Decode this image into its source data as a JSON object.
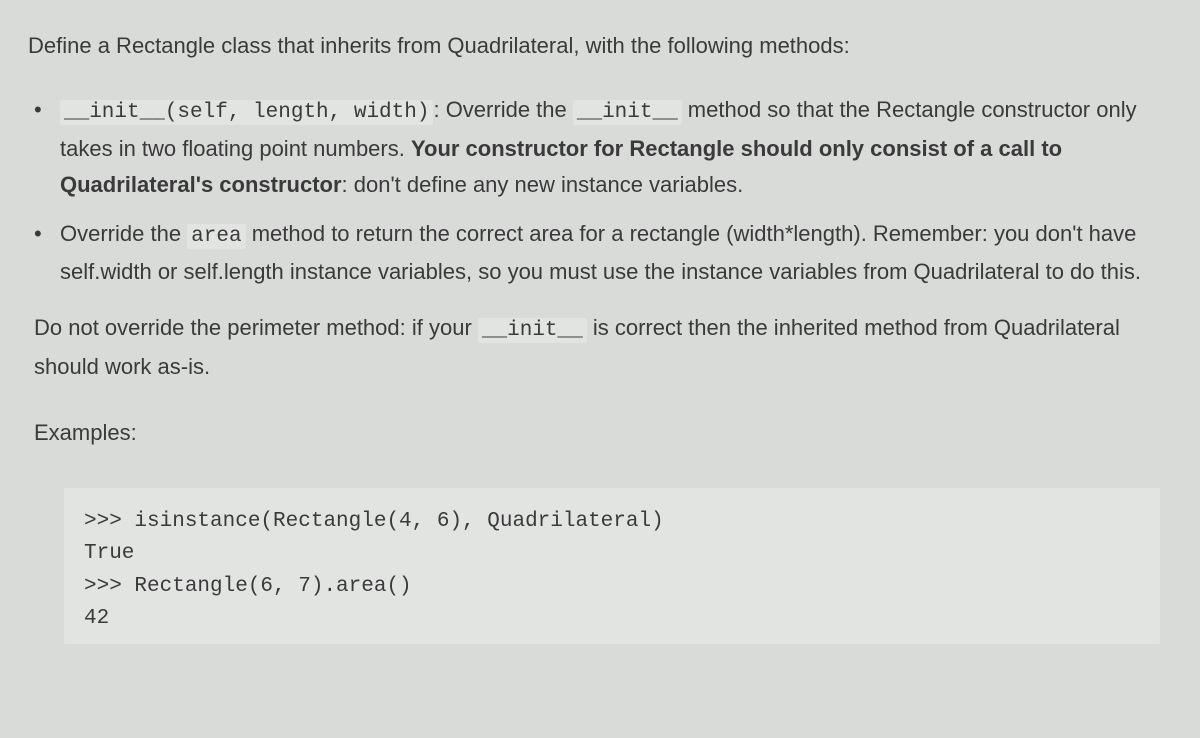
{
  "intro": "Define a Rectangle class that inherits from Quadrilateral, with the following methods:",
  "bullets": [
    {
      "code1": "__init__(self, length, width)",
      "text1": ": Override the ",
      "code2": "__init__",
      "text2": " method so that the Rectangle constructor only takes in two floating point numbers.  ",
      "bold1": "Your constructor for Rectangle should only consist of a call to Quadrilateral's constructor",
      "text3": ": don't define any new instance variables."
    },
    {
      "pre": "Override the ",
      "code1": "area",
      "text1": " method to return the correct area for a rectangle (width*length). Remember: you don't have self.width or self.length instance variables, so you must use the instance variables from Quadrilateral to do this."
    }
  ],
  "p2": {
    "text1": "Do not override the perimeter method: if your ",
    "code1": "__init__",
    "text2": " is correct then the inherited method from Quadrilateral should work as-is."
  },
  "examples_label": "Examples:",
  "code_block": {
    "l1": ">>> isinstance(Rectangle(4, 6), Quadrilateral)",
    "l2": "True",
    "l3": ">>> Rectangle(6, 7).area()",
    "l4": "42"
  }
}
